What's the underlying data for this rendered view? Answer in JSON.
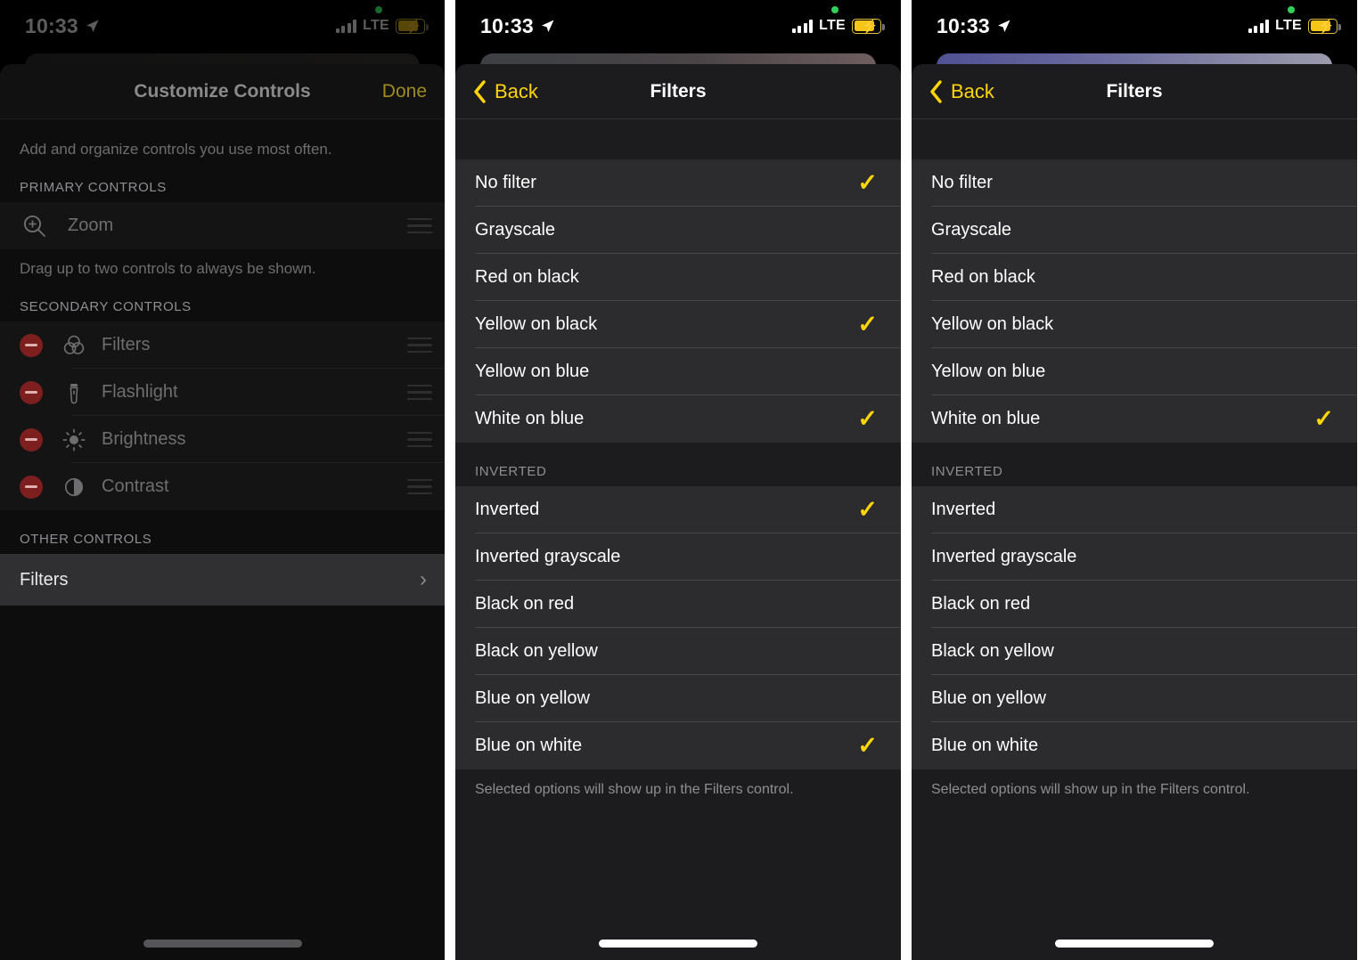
{
  "status_bar": {
    "time": "10:33",
    "location_icon": "location-arrow-icon",
    "signal_icon": "cellular-bars-icon",
    "network": "LTE",
    "battery_icon": "battery-charging-icon",
    "recording_dot": "green-privacy-dot"
  },
  "panel1": {
    "nav": {
      "title": "Customize Controls",
      "done_label": "Done"
    },
    "intro_hint": "Add and organize controls you use most often.",
    "primary_header": "PRIMARY CONTROLS",
    "primary_items": [
      {
        "label": "Zoom",
        "icon": "zoom-magnifier-plus-icon"
      }
    ],
    "primary_hint": "Drag up to two controls to always be shown.",
    "secondary_header": "SECONDARY CONTROLS",
    "secondary_items": [
      {
        "label": "Filters",
        "icon": "filters-venn-circles-icon"
      },
      {
        "label": "Flashlight",
        "icon": "flashlight-icon"
      },
      {
        "label": "Brightness",
        "icon": "brightness-sun-icon"
      },
      {
        "label": "Contrast",
        "icon": "contrast-half-circle-icon"
      }
    ],
    "other_header": "OTHER CONTROLS",
    "other_items": [
      {
        "label": "Filters",
        "accessory": "chevron-right-icon"
      }
    ]
  },
  "panel2": {
    "nav": {
      "back_label": "Back",
      "title": "Filters"
    },
    "filters": [
      {
        "label": "No filter",
        "checked": true
      },
      {
        "label": "Grayscale",
        "checked": false
      },
      {
        "label": "Red on black",
        "checked": false
      },
      {
        "label": "Yellow on black",
        "checked": true
      },
      {
        "label": "Yellow on blue",
        "checked": false
      },
      {
        "label": "White on blue",
        "checked": true
      }
    ],
    "inverted_header": "INVERTED",
    "inverted": [
      {
        "label": "Inverted",
        "checked": true
      },
      {
        "label": "Inverted grayscale",
        "checked": false
      },
      {
        "label": "Black on red",
        "checked": false
      },
      {
        "label": "Black on yellow",
        "checked": false
      },
      {
        "label": "Blue on yellow",
        "checked": false
      },
      {
        "label": "Blue on white",
        "checked": true
      }
    ],
    "footnote": "Selected options will show up in the Filters control."
  },
  "panel3": {
    "nav": {
      "back_label": "Back",
      "title": "Filters"
    },
    "filters": [
      {
        "label": "No filter",
        "checked": false
      },
      {
        "label": "Grayscale",
        "checked": false
      },
      {
        "label": "Red on black",
        "checked": false
      },
      {
        "label": "Yellow on black",
        "checked": false
      },
      {
        "label": "Yellow on blue",
        "checked": false
      },
      {
        "label": "White on blue",
        "checked": true
      }
    ],
    "inverted_header": "INVERTED",
    "inverted": [
      {
        "label": "Inverted",
        "checked": false
      },
      {
        "label": "Inverted grayscale",
        "checked": false
      },
      {
        "label": "Black on red",
        "checked": false
      },
      {
        "label": "Black on yellow",
        "checked": false
      },
      {
        "label": "Blue on yellow",
        "checked": false
      },
      {
        "label": "Blue on white",
        "checked": false
      }
    ],
    "footnote": "Selected options will show up in the Filters control."
  },
  "colors": {
    "accent_yellow": "#ffd60a",
    "dimmed_yellow": "#a08a22",
    "remove_red": "#7e1f1f",
    "list_bg": "#2c2c2e",
    "sheet_bg": "#1c1c1e",
    "secondary_text": "#8e8e93"
  },
  "checkmark_glyph": "✓"
}
